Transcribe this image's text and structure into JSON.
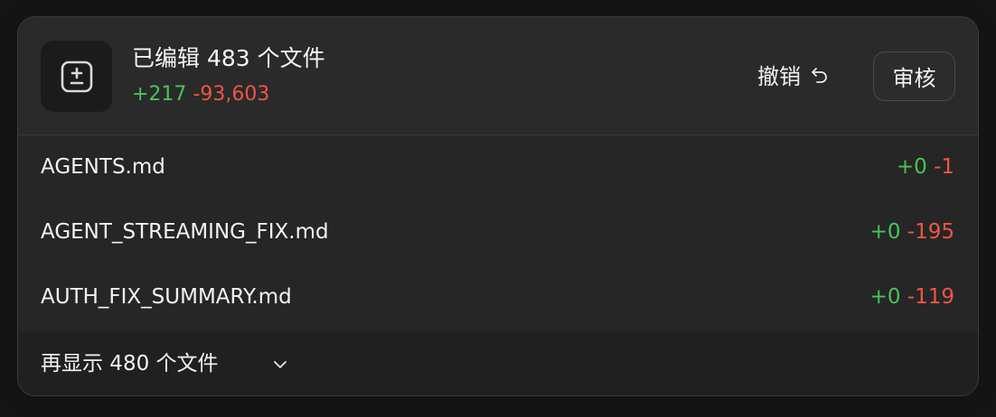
{
  "summary": {
    "title": "已编辑 483 个文件",
    "added": "+217",
    "removed": "-93,603",
    "icon": "diff-plus-minus-icon"
  },
  "actions": {
    "undo_label": "撤销",
    "undo_icon": "undo-arrow-icon",
    "review_label": "审核"
  },
  "files": [
    {
      "name": "AGENTS.md",
      "added": "+0",
      "removed": "-1"
    },
    {
      "name": "AGENT_STREAMING_FIX.md",
      "added": "+0",
      "removed": "-195"
    },
    {
      "name": "AUTH_FIX_SUMMARY.md",
      "added": "+0",
      "removed": "-119"
    }
  ],
  "show_more": {
    "label": "再显示 480 个文件",
    "icon": "chevron-down-icon"
  },
  "colors": {
    "added": "#45c45b",
    "removed": "#ef5544",
    "card_bg": "#262626"
  }
}
